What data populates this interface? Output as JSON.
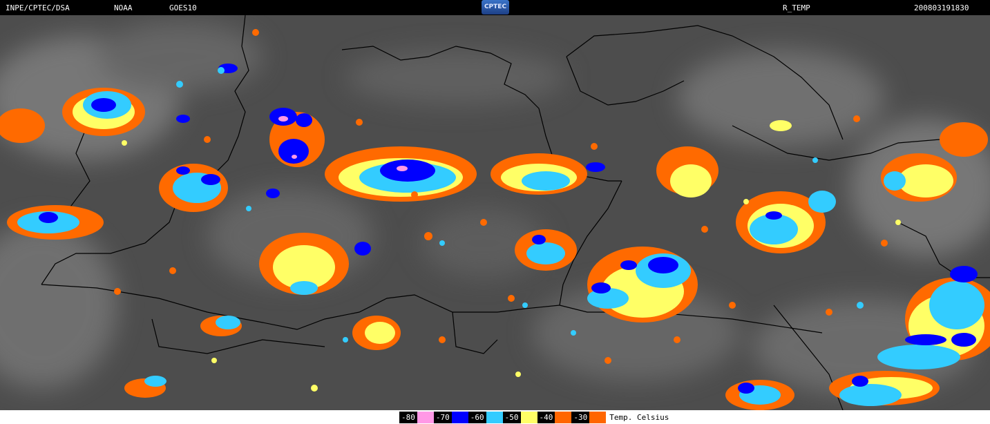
{
  "header": {
    "source": "INPE/CPTEC/DSA",
    "agency": "NOAA",
    "satellite": "GOES10",
    "logo_text": "CPTEC",
    "product": "R_TEMP",
    "timestamp": "200803191830"
  },
  "legend": {
    "title": "Temp. Celsius",
    "items": [
      {
        "label": "-80",
        "color": "#ff99e6"
      },
      {
        "label": "-70",
        "color": "#0000ff"
      },
      {
        "label": "-60",
        "color": "#33ccff"
      },
      {
        "label": "-50",
        "color": "#ffff66"
      },
      {
        "label": "-40",
        "color": "#ff6600"
      },
      {
        "label": "-30",
        "color": "#ff6600"
      }
    ]
  },
  "map": {
    "background_color": "#4f4f4f",
    "border_color": "#000000",
    "colors": {
      "orange": "#ff6a00",
      "yellow": "#ffff66",
      "cyan": "#33ccff",
      "blue": "#0000ff",
      "pink": "#ff99e6"
    }
  }
}
